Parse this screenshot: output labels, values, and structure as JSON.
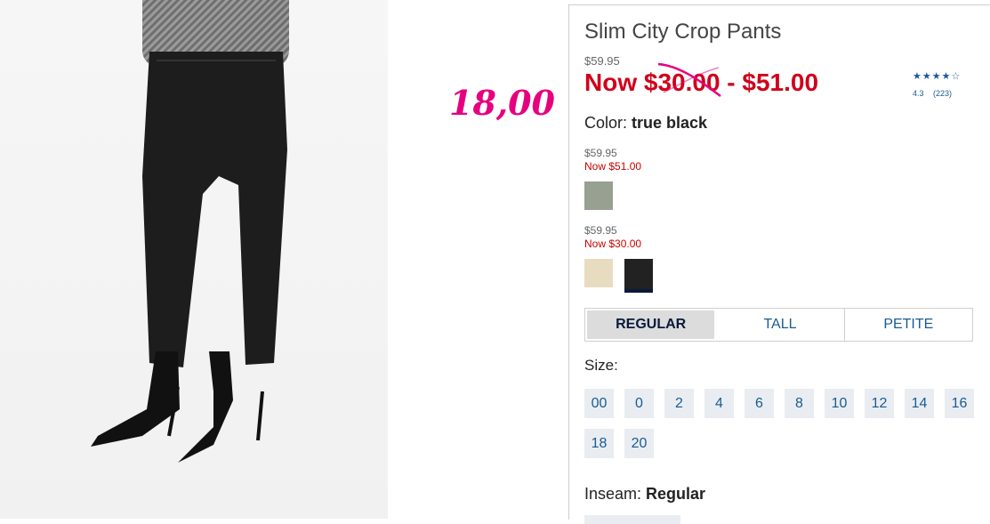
{
  "product": {
    "title": "Slim City Crop Pants",
    "original_price": "$59.95",
    "now_price": "Now $30.00 - $51.00"
  },
  "annotation": "18,00",
  "rating": {
    "stars": "★★★★☆",
    "score": "4.3",
    "count": "(223)"
  },
  "color": {
    "label": "Color:",
    "value": "true black"
  },
  "price_groups": [
    {
      "was": "$59.95",
      "now": "Now $51.00",
      "swatches": [
        {
          "hex": "#97a091"
        }
      ]
    },
    {
      "was": "$59.95",
      "now": "Now $30.00",
      "swatches": [
        {
          "hex": "#e8dcc0"
        },
        {
          "hex": "#222222"
        }
      ]
    }
  ],
  "fits": [
    "REGULAR",
    "TALL",
    "PETITE"
  ],
  "size": {
    "label": "Size:",
    "options": [
      "00",
      "0",
      "2",
      "4",
      "6",
      "8",
      "10",
      "12",
      "14",
      "16",
      "18",
      "20"
    ]
  },
  "inseam": {
    "label": "Inseam:",
    "value": "Regular"
  }
}
